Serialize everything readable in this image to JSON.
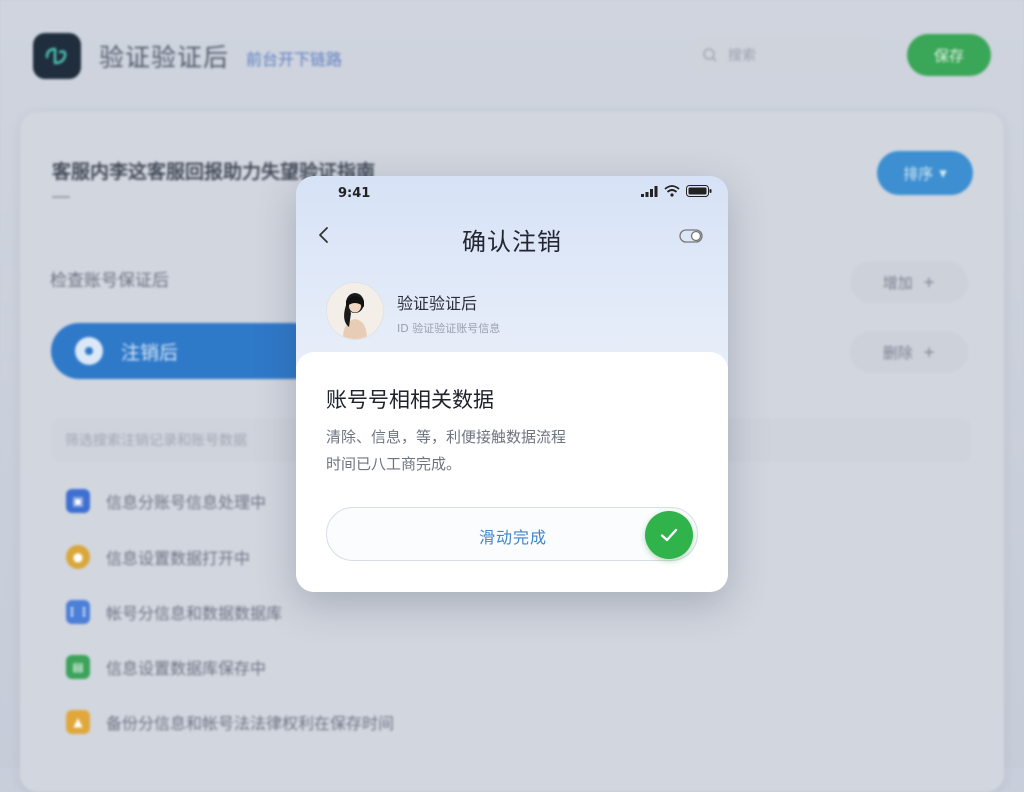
{
  "background": {
    "app_title": "验证验证后",
    "app_subtitle": "前台开下链路",
    "search_placeholder": "搜索",
    "top_button_label": "保存",
    "section_title": "客服内李这客服回报助力失望验证指南",
    "dropdown_label": "排序",
    "sub_heading": "检查账号保证后",
    "chip_labels": [
      "增加",
      "删除"
    ],
    "primary_button_label": "注销后",
    "filter_placeholder": "筛选搜索注销记录和账号数据",
    "list_items": [
      {
        "label": "信息分账号信息处理中",
        "icon": "calendar-icon",
        "color": "#3e6fd1"
      },
      {
        "label": "信息设置数据打开中",
        "icon": "coin-icon",
        "color": "#d9a73a"
      },
      {
        "label": "帐号分信息和数据数据库",
        "icon": "grid-icon",
        "color": "#4b7fd8"
      },
      {
        "label": "信息设置数据库保存中",
        "icon": "chat-icon",
        "color": "#3ba35a"
      },
      {
        "label": "备份分信息和帐号法法律权利在保存时间",
        "icon": "person-icon",
        "color": "#e0a83c"
      }
    ]
  },
  "modal": {
    "status_time": "9:41",
    "title": "确认注销",
    "profile_name": "验证验证后",
    "profile_sub": "ID 验证验证账号信息",
    "sheet_title": "账号号相相关数据",
    "sheet_desc_line1": "清除、信息，等，利便接触数据流程",
    "sheet_desc_line2": "时间已八工商完成。",
    "confirm_label": "滑动完成",
    "accent_color": "#2fb34a",
    "link_color": "#3f86c9"
  }
}
